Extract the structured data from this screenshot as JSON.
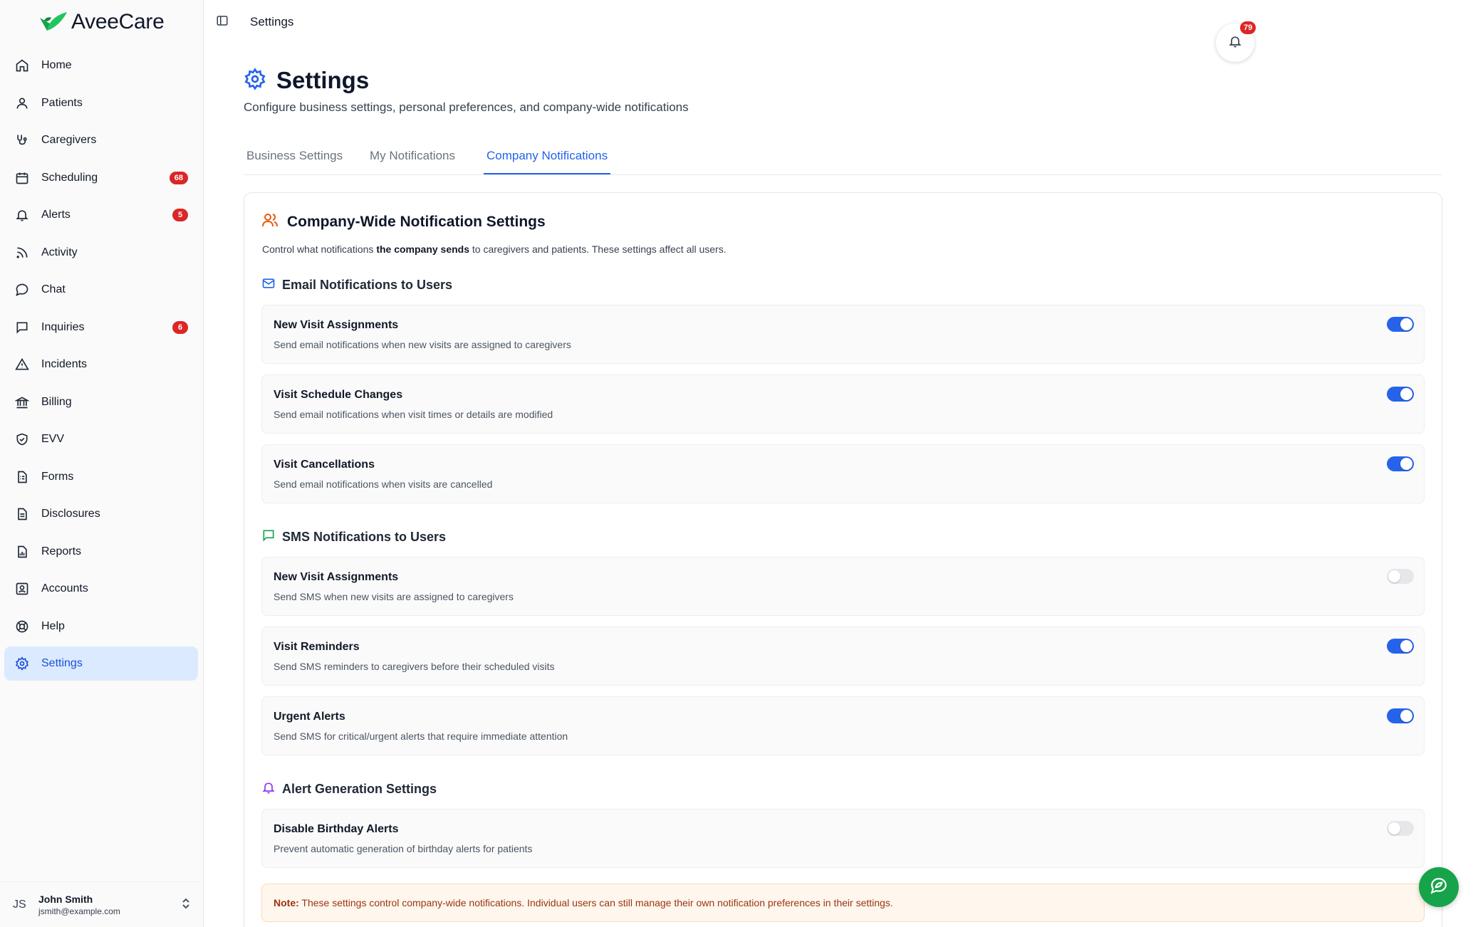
{
  "app": {
    "name": "AveeCare"
  },
  "sidebar": {
    "items": [
      {
        "label": "Home",
        "icon": "home-icon"
      },
      {
        "label": "Patients",
        "icon": "user-icon"
      },
      {
        "label": "Caregivers",
        "icon": "stethoscope-icon"
      },
      {
        "label": "Scheduling",
        "icon": "calendar-icon",
        "badge": "68"
      },
      {
        "label": "Alerts",
        "icon": "bell-icon",
        "badge": "5"
      },
      {
        "label": "Activity",
        "icon": "rss-icon"
      },
      {
        "label": "Chat",
        "icon": "chat-icon"
      },
      {
        "label": "Inquiries",
        "icon": "message-square-icon",
        "badge": "6"
      },
      {
        "label": "Incidents",
        "icon": "warning-icon"
      },
      {
        "label": "Billing",
        "icon": "bank-icon"
      },
      {
        "label": "EVV",
        "icon": "shield-check-icon"
      },
      {
        "label": "Forms",
        "icon": "form-icon"
      },
      {
        "label": "Disclosures",
        "icon": "document-icon"
      },
      {
        "label": "Reports",
        "icon": "report-icon"
      },
      {
        "label": "Accounts",
        "icon": "contact-icon"
      },
      {
        "label": "Help",
        "icon": "lifebuoy-icon"
      },
      {
        "label": "Settings",
        "icon": "gear-icon",
        "active": true
      }
    ],
    "user": {
      "initials": "JS",
      "name": "John Smith",
      "email": "jsmith@example.com"
    }
  },
  "header": {
    "breadcrumb": "Settings",
    "notification_count": "79"
  },
  "page": {
    "title": "Settings",
    "subtitle": "Configure business settings, personal preferences, and company-wide notifications",
    "tabs": [
      {
        "label": "Business Settings",
        "active": false
      },
      {
        "label": "My Notifications",
        "active": false
      },
      {
        "label": "Company Notifications",
        "active": true
      }
    ]
  },
  "card": {
    "title": "Company-Wide Notification Settings",
    "desc_pre": "Control what notifications ",
    "desc_bold": "the company sends",
    "desc_post": " to caregivers and patients. These settings affect all users.",
    "sections": [
      {
        "title": "Email Notifications to Users",
        "icon": "mail-icon",
        "rows": [
          {
            "title": "New Visit Assignments",
            "desc": "Send email notifications when new visits are assigned to caregivers",
            "enabled": true
          },
          {
            "title": "Visit Schedule Changes",
            "desc": "Send email notifications when visit times or details are modified",
            "enabled": true
          },
          {
            "title": "Visit Cancellations",
            "desc": "Send email notifications when visits are cancelled",
            "enabled": true
          }
        ]
      },
      {
        "title": "SMS Notifications to Users",
        "icon": "message-square-icon",
        "rows": [
          {
            "title": "New Visit Assignments",
            "desc": "Send SMS when new visits are assigned to caregivers",
            "enabled": false
          },
          {
            "title": "Visit Reminders",
            "desc": "Send SMS reminders to caregivers before their scheduled visits",
            "enabled": true
          },
          {
            "title": "Urgent Alerts",
            "desc": "Send SMS for critical/urgent alerts that require immediate attention",
            "enabled": true
          }
        ]
      },
      {
        "title": "Alert Generation Settings",
        "icon": "bell-icon",
        "rows": [
          {
            "title": "Disable Birthday Alerts",
            "desc": "Prevent automatic generation of birthday alerts for patients",
            "enabled": false
          }
        ]
      }
    ],
    "note_label": "Note:",
    "note_text": " These settings control company-wide notifications. Individual users can still manage their own notification preferences in their settings."
  },
  "colors": {
    "accent": "#2563eb",
    "badge": "#dc2626",
    "brand_green": "#16a34a",
    "active_nav_bg": "#dbeafe"
  }
}
